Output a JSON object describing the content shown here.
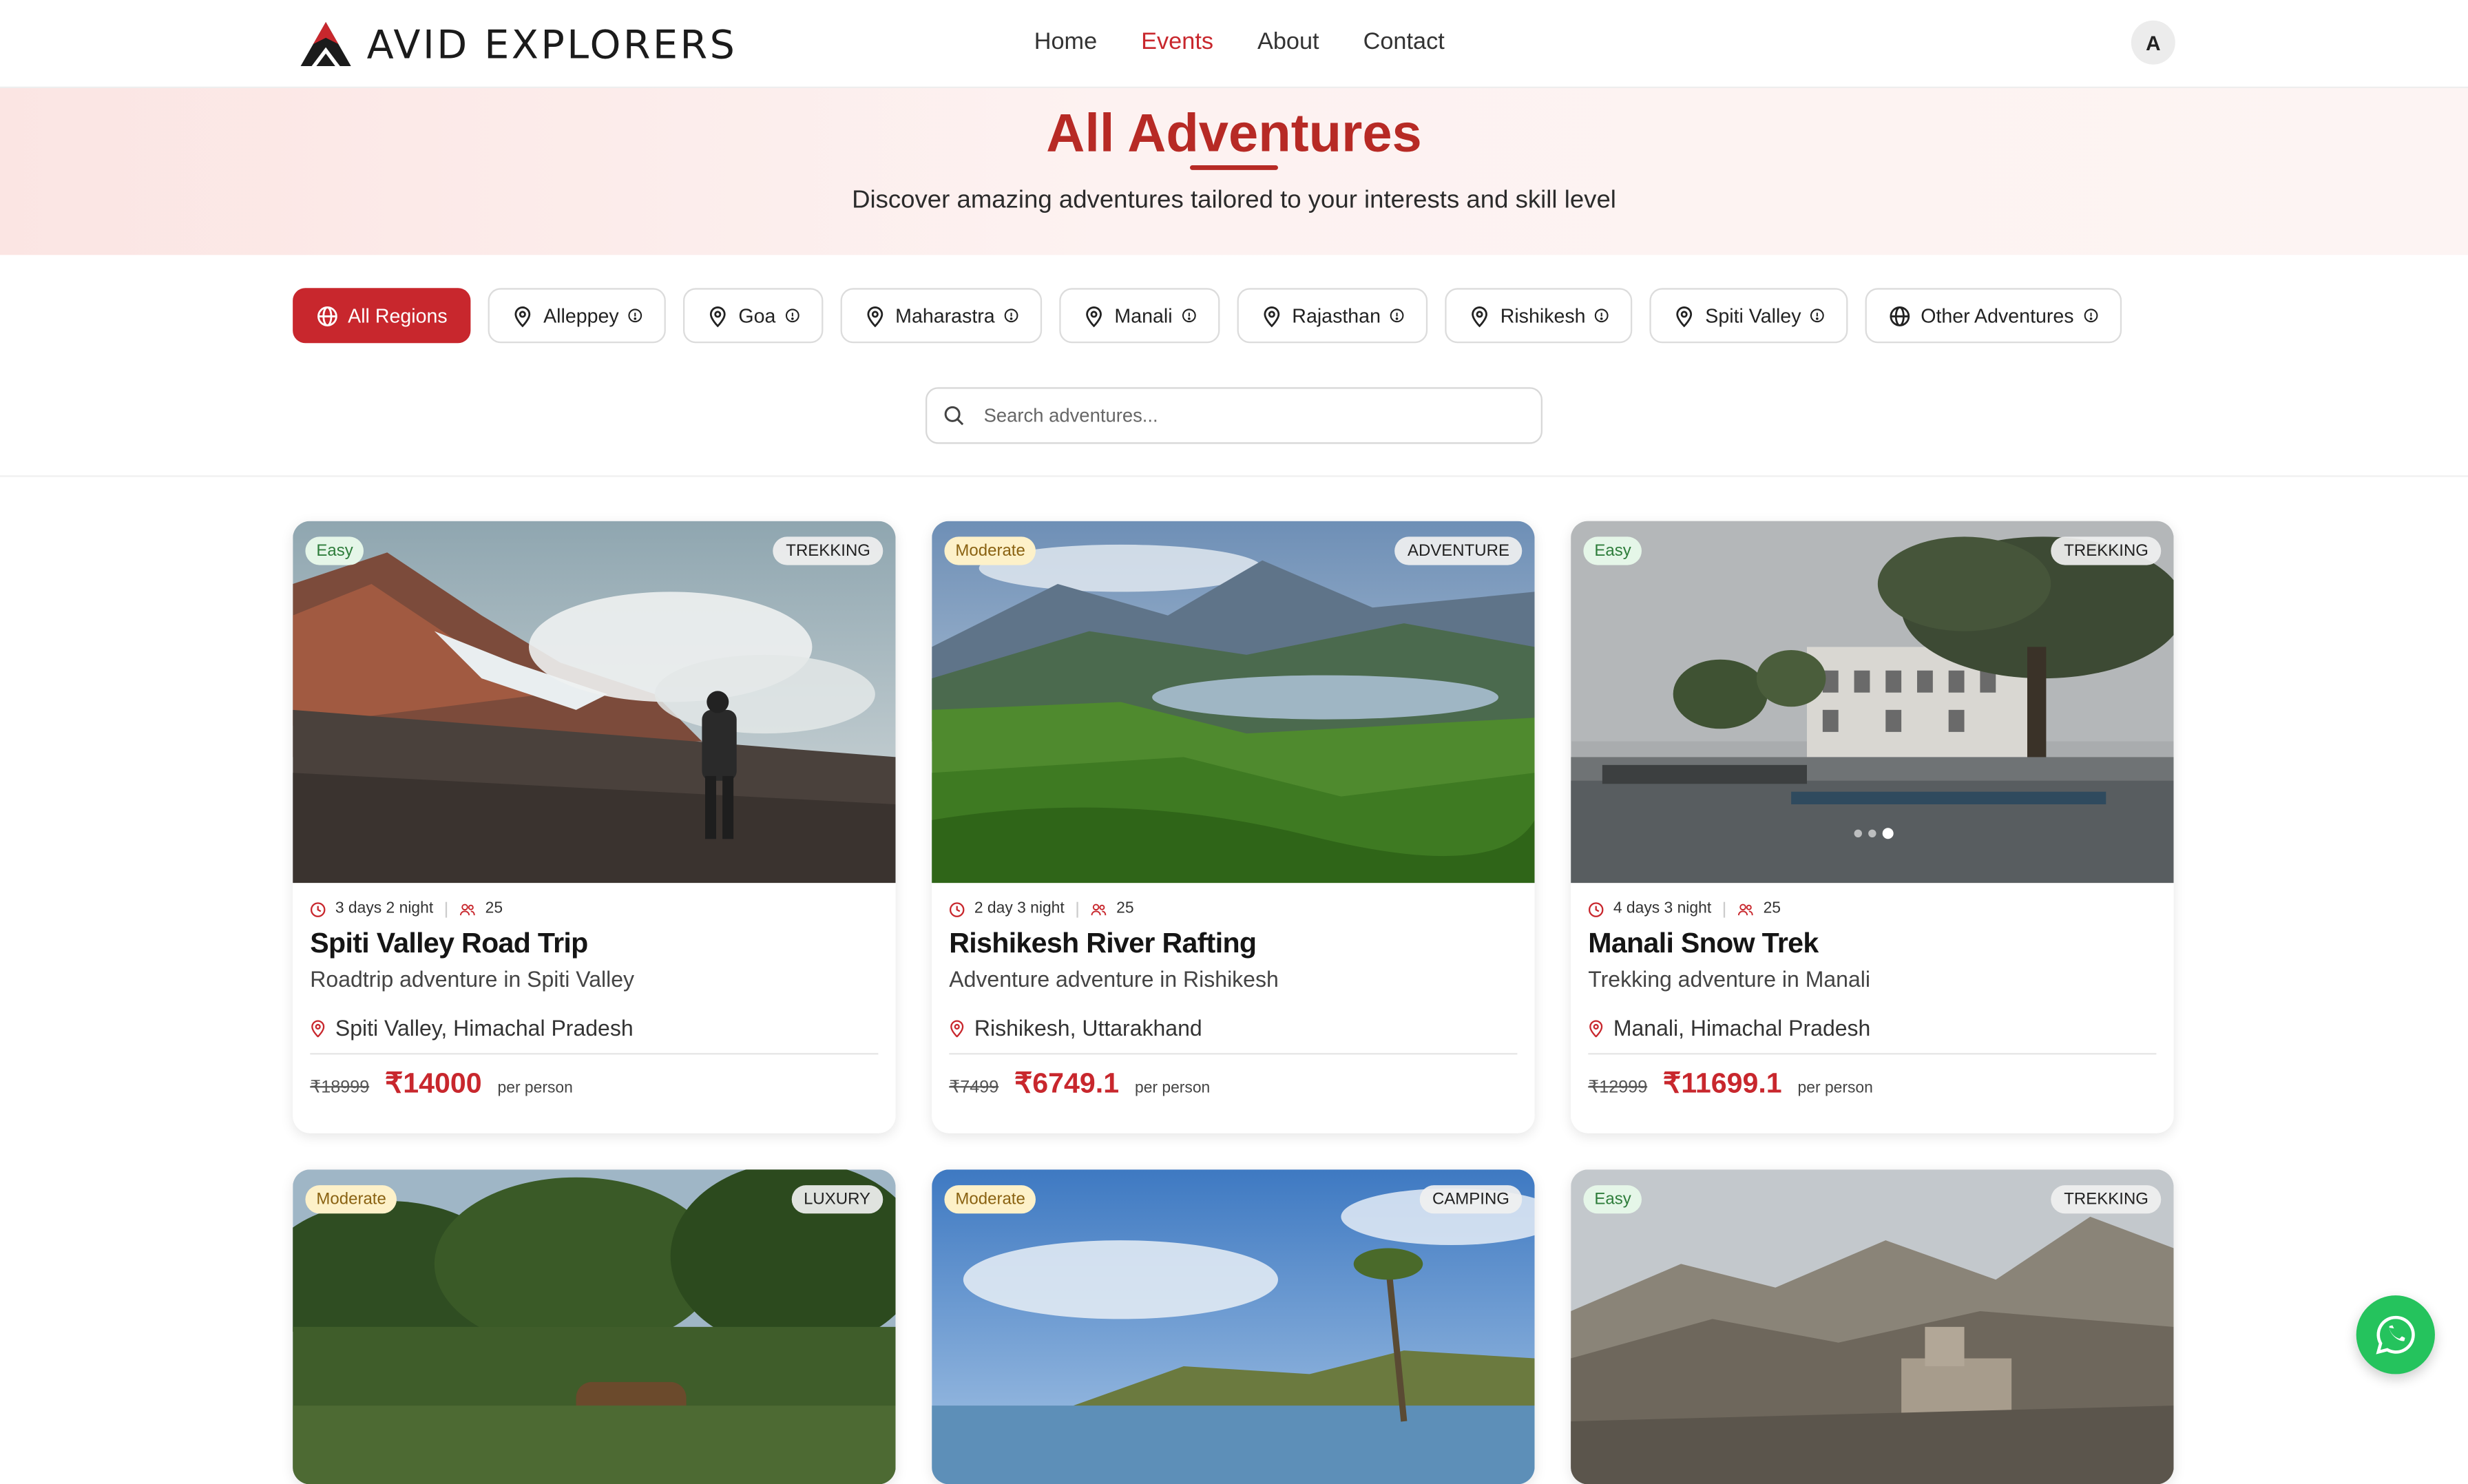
{
  "brand": {
    "name": "AVID EXPLORERS"
  },
  "nav": {
    "links": [
      "Home",
      "Events",
      "About",
      "Contact"
    ],
    "active": "Events",
    "avatar_initial": "A"
  },
  "hero": {
    "title": "All Adventures",
    "subtitle": "Discover amazing adventures tailored to your interests and skill level"
  },
  "filters": [
    "All Regions",
    "Alleppey",
    "Goa",
    "Maharastra",
    "Manali",
    "Rajasthan",
    "Rishikesh",
    "Spiti Valley",
    "Other Adventures"
  ],
  "active_filter": "All Regions",
  "search": {
    "placeholder": "Search adventures..."
  },
  "cards": [
    {
      "difficulty": "Easy",
      "category": "TREKKING",
      "duration": "3 days 2 night",
      "capacity": "25",
      "title": "Spiti Valley Road Trip",
      "subtitle": "Roadtrip adventure in Spiti Valley",
      "location": "Spiti Valley, Himachal Pradesh",
      "old_price": "₹18999",
      "price": "₹14000",
      "per": "per person"
    },
    {
      "difficulty": "Moderate",
      "category": "ADVENTURE",
      "duration": "2 day 3 night",
      "capacity": "25",
      "title": "Rishikesh River Rafting",
      "subtitle": "Adventure adventure in Rishikesh",
      "location": "Rishikesh, Uttarakhand",
      "old_price": "₹7499",
      "price": "₹6749.1",
      "per": "per person"
    },
    {
      "difficulty": "Easy",
      "category": "TREKKING",
      "duration": "4 days 3 night",
      "capacity": "25",
      "title": "Manali Snow Trek",
      "subtitle": "Trekking adventure in Manali",
      "location": "Manali, Himachal Pradesh",
      "old_price": "₹12999",
      "price": "₹11699.1",
      "per": "per person"
    },
    {
      "difficulty": "Moderate",
      "category": "LUXURY"
    },
    {
      "difficulty": "Moderate",
      "category": "CAMPING"
    },
    {
      "difficulty": "Easy",
      "category": "TREKKING"
    }
  ],
  "colors": {
    "brand_red": "#c8272d",
    "whatsapp_green": "#25c35d"
  }
}
